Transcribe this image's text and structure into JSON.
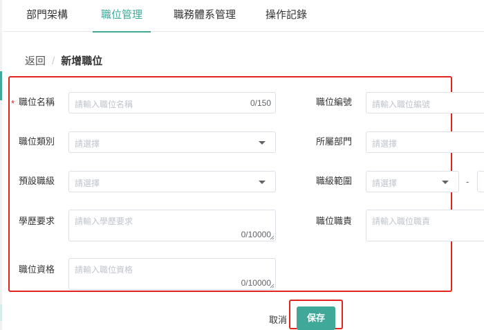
{
  "tabs": [
    {
      "label": "部門架構",
      "active": false
    },
    {
      "label": "職位管理",
      "active": true
    },
    {
      "label": "職務體系管理",
      "active": false
    },
    {
      "label": "操作記錄",
      "active": false
    }
  ],
  "breadcrumb": {
    "back": "返回",
    "separator": "/",
    "current": "新增職位"
  },
  "form": {
    "required_mark": "*",
    "position_name": {
      "label": "職位名稱",
      "placeholder": "請輸入職位名稱",
      "count": "0/150"
    },
    "position_code": {
      "label": "職位編號",
      "placeholder": "請輸入職位編號"
    },
    "position_type": {
      "label": "職位類別",
      "placeholder": "請選擇"
    },
    "department": {
      "label": "所屬部門",
      "placeholder": "請選擇"
    },
    "default_level": {
      "label": "預設職級",
      "placeholder": "請選擇"
    },
    "level_range": {
      "label": "職級範圍",
      "placeholder": "請選擇",
      "separator": "-"
    },
    "education": {
      "label": "學歷要求",
      "placeholder": "請輸入學歷要求",
      "count": "0/10000"
    },
    "duties": {
      "label": "職位職責",
      "placeholder": "請輸入職位職責"
    },
    "qualification": {
      "label": "職位資格",
      "placeholder": "請輸入職位資格",
      "count": "0/10000"
    }
  },
  "actions": {
    "cancel": "取消",
    "save": "保存"
  },
  "colors": {
    "accent": "#3fa899",
    "highlight": "#e0231d"
  }
}
